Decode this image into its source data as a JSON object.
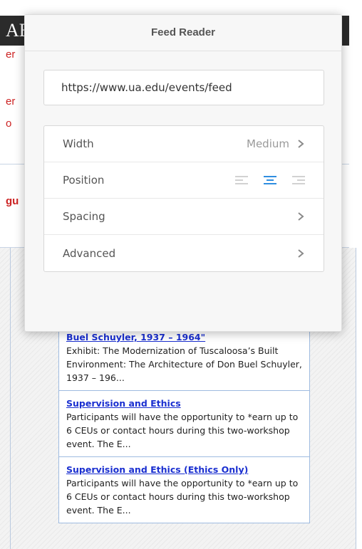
{
  "background": {
    "header_fragment": "AE",
    "left_fragments": [
      "er",
      "er",
      "o",
      "gu"
    ],
    "feed_items": [
      {
        "title": "Buel Schuyler, 1937 – 1964\"",
        "description": "Exhibit: The Modernization of Tuscaloosa’s Built Environment: The Architecture of Don Buel Schuyler, 1937 – 196..."
      },
      {
        "title": "Supervision and Ethics",
        "description": "Participants will have the opportunity to *earn up to 6 CEUs or contact hours during this two-workshop event. The E..."
      },
      {
        "title": "Supervision and Ethics (Ethics Only)",
        "description": "Participants will have the opportunity to *earn up to 6 CEUs or contact hours during this two-workshop event. The E..."
      }
    ]
  },
  "panel": {
    "title": "Feed Reader",
    "url_value": "https://www.ua.edu/events/feed",
    "rows": {
      "width": {
        "label": "Width",
        "value": "Medium",
        "icon": "chevron-right-icon"
      },
      "position": {
        "label": "Position",
        "options": [
          "align-left-icon",
          "align-center-icon",
          "align-right-icon"
        ],
        "selected": "center"
      },
      "spacing": {
        "label": "Spacing",
        "icon": "chevron-right-icon"
      },
      "advanced": {
        "label": "Advanced",
        "icon": "chevron-right-icon"
      }
    }
  },
  "colors": {
    "accent": "#2f8ee0",
    "link": "#1a2fd0",
    "bg_red_text": "#cc2222"
  }
}
